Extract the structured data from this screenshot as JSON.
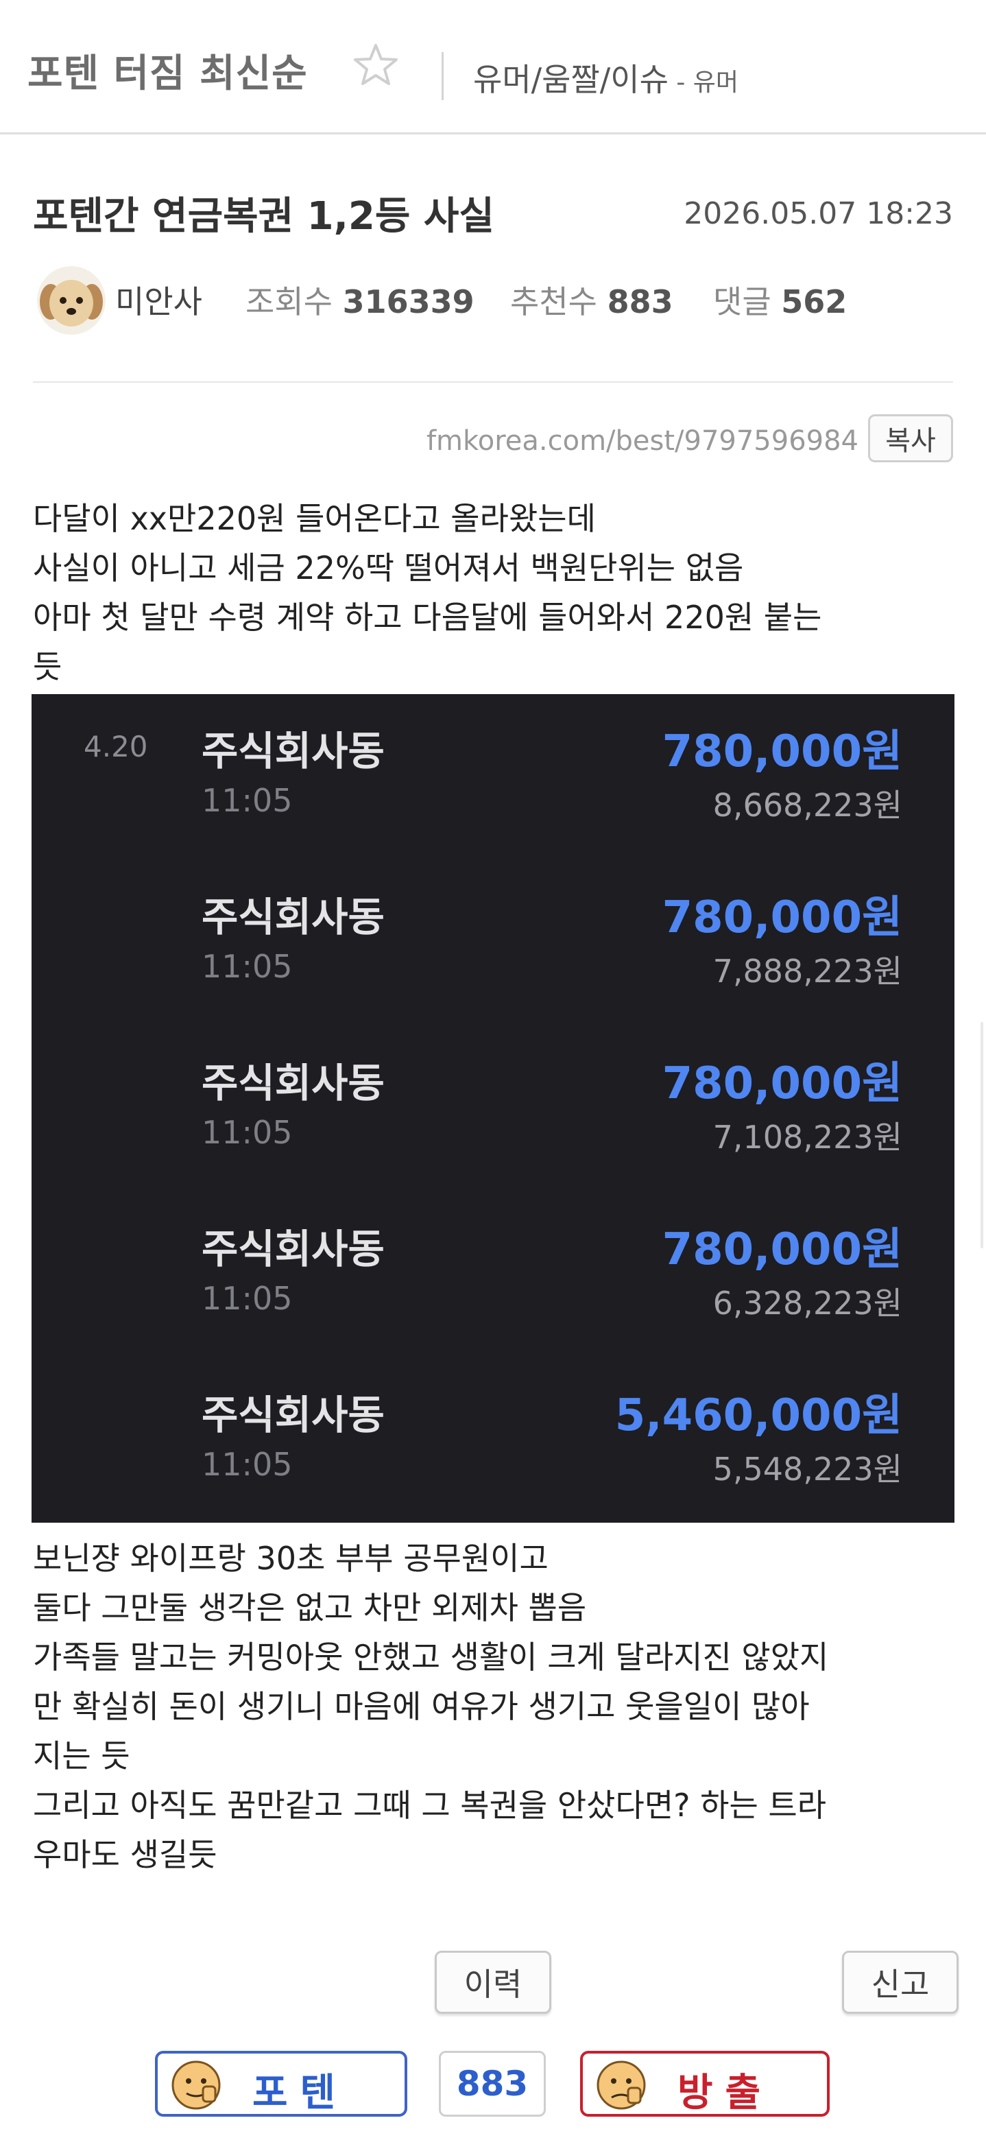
{
  "header": {
    "board_title": "포텐 터짐 최신순",
    "category": "유머/움짤/이슈",
    "category_sub": " - 유머",
    "star_icon": "star-outline-icon"
  },
  "post": {
    "title": "포텐간 연금복권 1,2등 사실",
    "date": "2026.05.07 18:23",
    "author": "미안사",
    "avatar_icon": "puppy-avatar",
    "views_label": "조회수",
    "views": "316339",
    "recommend_label": "추천수",
    "recommend": "883",
    "comments_label": "댓글",
    "comments": "562",
    "url": "fmkorea.com/best/9797596984",
    "copy_label": "복사"
  },
  "body_top": [
    "다달이 xx만220원 들어온다고 올라왔는데",
    "사실이 아니고 세금 22%딱 떨어져서 백원단위는 없음",
    "아마 첫 달만 수령 계약 하고 다음달에 들어와서 220원 붙는",
    "듯"
  ],
  "transactions": [
    {
      "date": "4.20",
      "name": "주식회사동",
      "time": "11:05",
      "amount": "780,000원",
      "balance": "8,668,223원"
    },
    {
      "date": "",
      "name": "주식회사동",
      "time": "11:05",
      "amount": "780,000원",
      "balance": "7,888,223원"
    },
    {
      "date": "",
      "name": "주식회사동",
      "time": "11:05",
      "amount": "780,000원",
      "balance": "7,108,223원"
    },
    {
      "date": "",
      "name": "주식회사동",
      "time": "11:05",
      "amount": "780,000원",
      "balance": "6,328,223원"
    },
    {
      "date": "",
      "name": "주식회사동",
      "time": "11:05",
      "amount": "5,460,000원",
      "balance": "5,548,223원"
    }
  ],
  "body_bottom": [
    "보닌쟝 와이프랑 30초 부부 공무원이고",
    "둘다 그만둘 생각은 없고 차만 외제차 뽑음",
    "가족들 말고는 커밍아웃 안했고 생활이 크게 달라지진 않았지",
    "만 확실히 돈이 생기니 마음에 여유가 생기고 웃을일이 많아",
    "지는 듯",
    "그리고 아직도 꿈만같고 그때 그 복권을 안샀다면? 하는 트라",
    "우마도 생길듯"
  ],
  "actions": {
    "history_label": "이력",
    "report_label": "신고",
    "vote_up_label": "포텐",
    "vote_count": "883",
    "vote_down_label": "방출"
  },
  "colors": {
    "amount_blue": "#4f86f2",
    "panel_bg": "#1d1d22",
    "vote_up_border": "#3f64c6",
    "vote_down_border": "#c9202c"
  }
}
